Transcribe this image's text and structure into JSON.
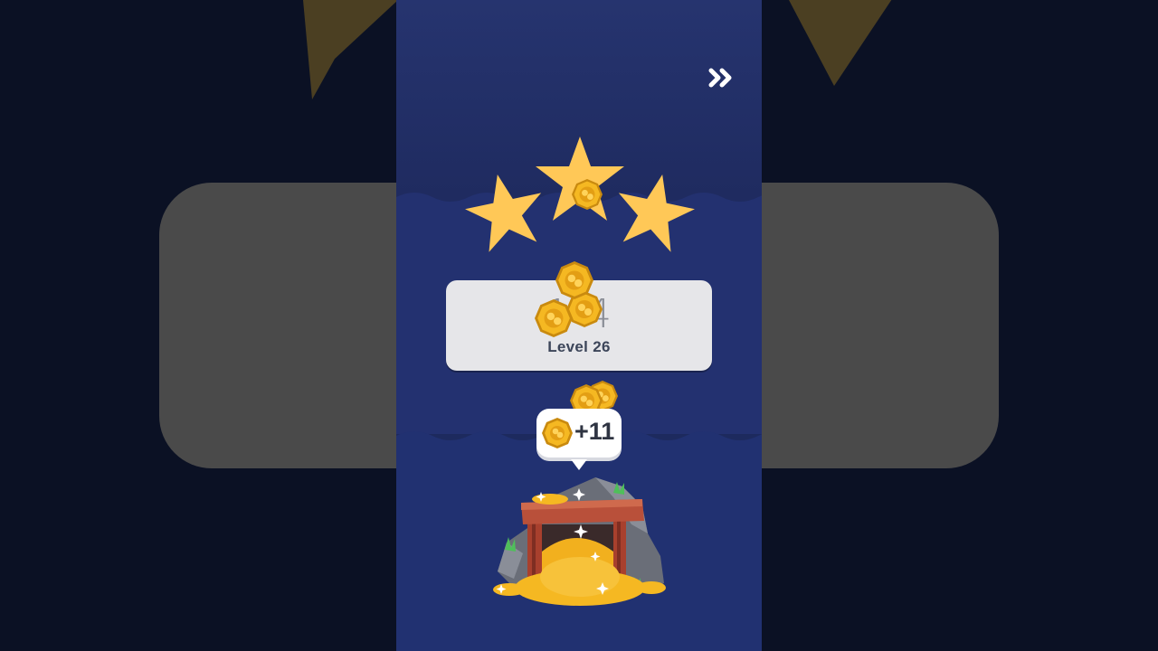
{
  "hud": {
    "skip_icon": "double-chevron-right-icon"
  },
  "result": {
    "stars_earned": 3,
    "stars_total": 3,
    "score_text": "1  4",
    "level_label": "Level 26"
  },
  "reward": {
    "amount_text": "+11",
    "currency_icon": "gold-coin-icon"
  },
  "treasure": {
    "icon": "gold-mine-icon"
  },
  "colors": {
    "background": "#1f2b60",
    "star": "#ffc857",
    "coin": "#f2b01e",
    "card": "#e6e6e9",
    "backdrop_panel": "#4a4a4a"
  }
}
